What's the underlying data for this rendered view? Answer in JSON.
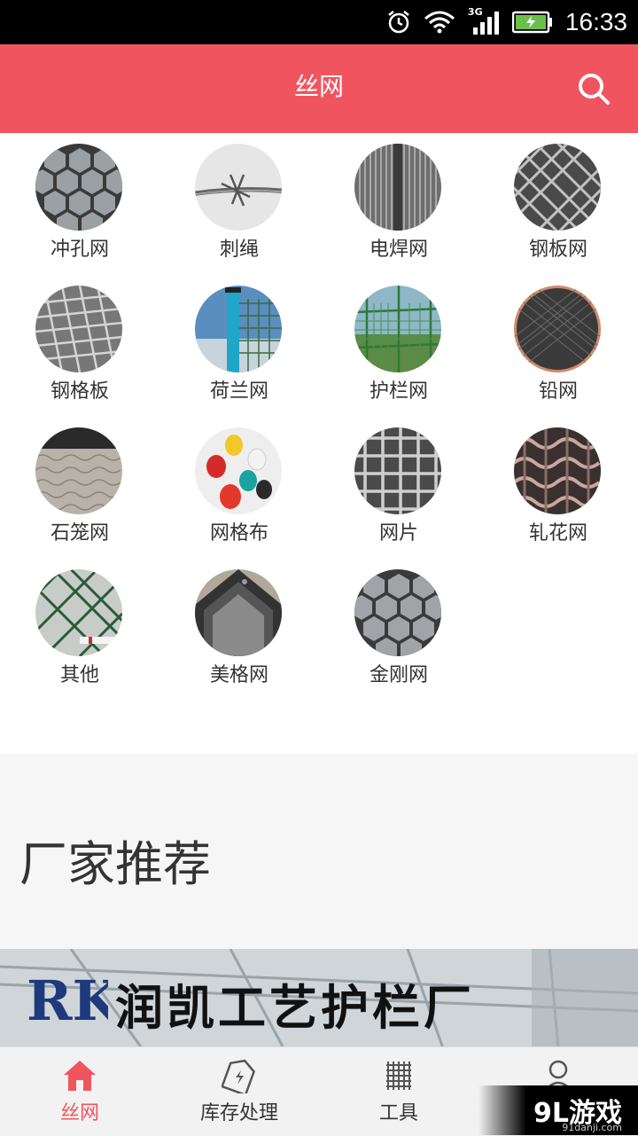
{
  "status_bar": {
    "time": "16:33",
    "network": "3G"
  },
  "header": {
    "title": "丝网"
  },
  "categories": [
    {
      "label": "冲孔网",
      "image": "perforated-hex-mesh"
    },
    {
      "label": "刺绳",
      "image": "barbed-wire"
    },
    {
      "label": "电焊网",
      "image": "welded-mesh-roll"
    },
    {
      "label": "钢板网",
      "image": "expanded-metal"
    },
    {
      "label": "钢格板",
      "image": "steel-grating"
    },
    {
      "label": "荷兰网",
      "image": "dutch-fence"
    },
    {
      "label": "护栏网",
      "image": "guardrail-fence"
    },
    {
      "label": "铅网",
      "image": "lead-wire-roll"
    },
    {
      "label": "石笼网",
      "image": "gabion-mesh"
    },
    {
      "label": "网格布",
      "image": "fiberglass-mesh-rolls"
    },
    {
      "label": "网片",
      "image": "welded-panel"
    },
    {
      "label": "轧花网",
      "image": "crimped-mesh"
    },
    {
      "label": "其他",
      "image": "chain-link"
    },
    {
      "label": "美格网",
      "image": "mesh-sheets"
    },
    {
      "label": "金刚网",
      "image": "diamond-mesh"
    }
  ],
  "recommend": {
    "title": "厂家推荐"
  },
  "banner": {
    "logo": "RK",
    "text": "润凯工艺护栏厂"
  },
  "bottom_nav": [
    {
      "label": "丝网",
      "icon": "home-icon",
      "active": true
    },
    {
      "label": "库存处理",
      "icon": "tag-icon",
      "active": false
    },
    {
      "label": "工具",
      "icon": "tools-icon",
      "active": false
    },
    {
      "label": "",
      "icon": "user-icon",
      "active": false
    }
  ],
  "watermark": {
    "logo": "9L游戏",
    "domain": "91danji.com"
  },
  "colors": {
    "accent": "#f0555f",
    "text": "#333333"
  }
}
